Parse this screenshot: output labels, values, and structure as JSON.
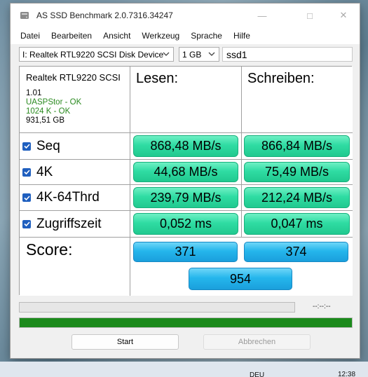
{
  "window": {
    "title": "AS SSD Benchmark 2.0.7316.34247"
  },
  "menu": {
    "items": [
      "Datei",
      "Bearbeiten",
      "Ansicht",
      "Werkzeug",
      "Sprache",
      "Hilfe"
    ]
  },
  "toolbar": {
    "disk_select": "I: Realtek RTL9220 SCSI Disk Device",
    "size_select": "1 GB",
    "name_input": "ssd1"
  },
  "info": {
    "device": "Realtek RTL9220 SCSI",
    "version": "1.01",
    "driver_status": "UASPStor - OK",
    "align_status": "1024 K - OK",
    "capacity": "931,51 GB"
  },
  "headers": {
    "read": "Lesen:",
    "write": "Schreiben:"
  },
  "rows": [
    {
      "label": "Seq",
      "read": "868,48 MB/s",
      "write": "866,84 MB/s",
      "checked": true
    },
    {
      "label": "4K",
      "read": "44,68 MB/s",
      "write": "75,49 MB/s",
      "checked": true
    },
    {
      "label": "4K-64Thrd",
      "read": "239,79 MB/s",
      "write": "212,24 MB/s",
      "checked": true
    },
    {
      "label": "Zugriffszeit",
      "read": "0,052 ms",
      "write": "0,047 ms",
      "checked": true
    }
  ],
  "score": {
    "label": "Score:",
    "read": "371",
    "write": "374",
    "total": "954"
  },
  "progress": {
    "time": "--:--:--",
    "bar1_fraction": 0,
    "bar2_fraction": 1.0
  },
  "buttons": {
    "start": "Start",
    "cancel": "Abbrechen"
  },
  "taskbar": {
    "lang": "DEU",
    "time": "12:38"
  },
  "colors": {
    "value_green": "#2fdca3",
    "score_blue": "#25b6ec",
    "progress_green": "#1c8a1c",
    "ok_green": "#2a8a1f"
  }
}
